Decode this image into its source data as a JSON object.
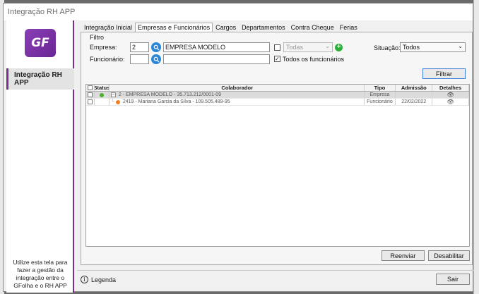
{
  "window": {
    "title": "Integração RH APP"
  },
  "sidebar": {
    "logo_text": "GF",
    "nav_label": "Integração RH APP",
    "note": "Utilize esta tela para fazer a gestão da integração entre o GFolha e o RH APP"
  },
  "tabs": [
    {
      "label": "Integração Inicial",
      "active": false
    },
    {
      "label": "Empresas e Funcionários",
      "active": true
    },
    {
      "label": "Cargos",
      "active": false
    },
    {
      "label": "Departamentos",
      "active": false
    },
    {
      "label": "Contra Cheque",
      "active": false
    },
    {
      "label": "Ferias",
      "active": false
    }
  ],
  "filter": {
    "title": "Filtro",
    "empresa_label": "Empresa:",
    "empresa_code": "2",
    "empresa_name": "EMPRESA MODELO",
    "funcionario_label": "Funcionário:",
    "funcionario_code": "",
    "funcionario_name": "",
    "todas_select": "Todas",
    "todos_funcionarios_label": "Todos os funcionários",
    "todos_funcionarios_checked": true,
    "situacao_label": "Situação:",
    "situacao_value": "Todos",
    "filtrar_button": "Filtrar"
  },
  "grid": {
    "columns": [
      "",
      "Status",
      "Colaborador",
      "Tipo",
      "Admissão",
      "Detalhes"
    ],
    "rows": [
      {
        "colaborador": "2 - EMPRESA MODELO - 35.713.212/0001-09",
        "tipo": "Empresa",
        "admissao": "",
        "status_color": "#4caf2a",
        "tree": "−",
        "selected": true
      },
      {
        "colaborador": "2419 - Mariana Garcia da Silva - 109.505.489-95",
        "tipo": "Funcionário",
        "admissao": "22/02/2022",
        "status_color": "#f0801f",
        "tree": "",
        "selected": false
      }
    ]
  },
  "buttons": {
    "reenviar": "Reenviar",
    "desabilitar": "Desabilitar",
    "sair": "Sair"
  },
  "footer": {
    "legend_label": "Legenda"
  },
  "colors": {
    "accent": "#7a2f8c",
    "lookup": "#2a86d6",
    "add": "#2fae3a"
  }
}
